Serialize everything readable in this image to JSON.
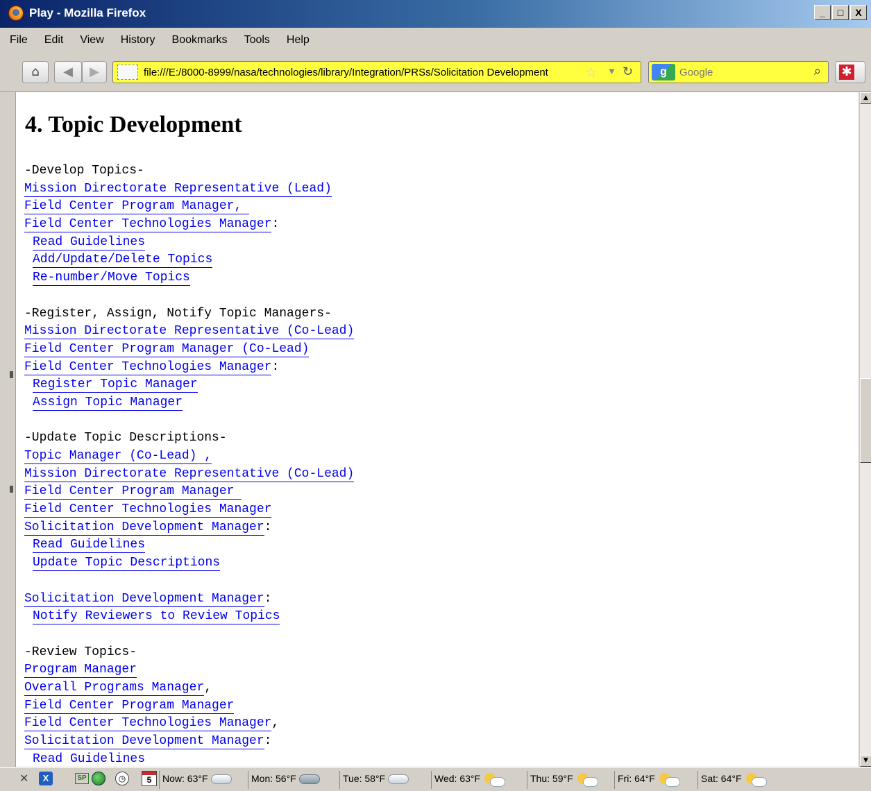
{
  "window": {
    "title": "Play - Mozilla Firefox",
    "controls": [
      "_",
      "□",
      "X"
    ]
  },
  "menu": [
    "File",
    "Edit",
    "View",
    "History",
    "Bookmarks",
    "Tools",
    "Help"
  ],
  "nav": {
    "url": "file:///E:/8000-8999/nasa/technologies/library/Integration/PRSs/Solicitation Development",
    "search_placeholder": "Google",
    "search_engine_icon": "google-icon"
  },
  "page": {
    "title": "4. Topic Development",
    "sections": [
      {
        "heading": "-Develop Topics-",
        "roles": [
          {
            "text": "Mission Directorate Representative (Lead)",
            "suffix": ""
          },
          {
            "text": "Field Center Program Manager, ",
            "suffix": ""
          },
          {
            "text": "Field Center Technologies Manager",
            "suffix": ":"
          }
        ],
        "actions": [
          "Read Guidelines",
          "Add/Update/Delete Topics",
          "Re-number/Move Topics"
        ]
      },
      {
        "heading": "-Register, Assign, Notify Topic Managers-",
        "roles": [
          {
            "text": "Mission Directorate Representative (Co-Lead)",
            "suffix": ""
          },
          {
            "text": "Field Center Program Manager (Co-Lead)",
            "suffix": ""
          },
          {
            "text": "Field Center Technologies Manager",
            "suffix": ":"
          }
        ],
        "actions": [
          "Register Topic Manager",
          "Assign Topic Manager"
        ]
      },
      {
        "heading": "-Update Topic Descriptions-",
        "roles": [
          {
            "text": "Topic Manager (Co-Lead) ,",
            "suffix": ""
          },
          {
            "text": "Mission Directorate Representative (Co-Lead)",
            "suffix": ""
          },
          {
            "text": "Field Center Program Manager ",
            "suffix": ""
          },
          {
            "text": "Field Center Technologies Manager",
            "suffix": ""
          },
          {
            "text": "Solicitation Development Manager",
            "suffix": ":"
          }
        ],
        "actions": [
          "Read Guidelines",
          "Update Topic Descriptions"
        ]
      },
      {
        "heading": "",
        "roles": [
          {
            "text": "Solicitation Development Manager",
            "suffix": ":"
          }
        ],
        "actions": [
          "Notify Reviewers to Review Topics"
        ]
      },
      {
        "heading": "-Review Topics-",
        "roles": [
          {
            "text": "Program Manager",
            "suffix": ""
          },
          {
            "text": "Overall Programs Manager",
            "suffix": ","
          },
          {
            "text": "Field Center Program Manager",
            "suffix": ""
          },
          {
            "text": "Field Center Technologies Manager",
            "suffix": ","
          },
          {
            "text": "Solicitation Development Manager",
            "suffix": ":"
          }
        ],
        "actions": [
          "Read Guidelines"
        ]
      }
    ]
  },
  "statusbar": {
    "calendar_day": "5",
    "sp_label": "SP",
    "weather": [
      {
        "label": "Now: 63°F",
        "icon": "cloud-icon"
      },
      {
        "label": "Mon: 56°F",
        "icon": "rain-icon"
      },
      {
        "label": "Tue: 58°F",
        "icon": "cloud-icon"
      },
      {
        "label": "Wed: 63°F",
        "icon": "sun-cloud-rain-icon"
      },
      {
        "label": "Thu: 59°F",
        "icon": "sun-cloud-icon"
      },
      {
        "label": "Fri: 64°F",
        "icon": "sun-cloud-icon"
      },
      {
        "label": "Sat: 64°F",
        "icon": "sun-cloud-icon"
      }
    ]
  },
  "colors": {
    "link": "#0000ee",
    "urlbar_bg": "#ffff40",
    "titlebar_start": "#0a246a",
    "titlebar_end": "#a6caf0"
  }
}
